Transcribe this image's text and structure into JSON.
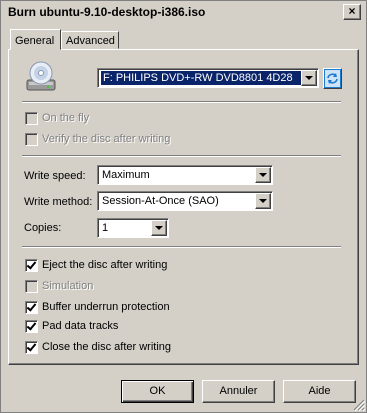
{
  "window": {
    "title": "Burn ubuntu-9.10-desktop-i386.iso",
    "close_label": "×"
  },
  "tabs": [
    {
      "label": "General",
      "active": true
    },
    {
      "label": "Advanced",
      "active": false
    }
  ],
  "drive": {
    "selected": "F: PHILIPS DVD+-RW DVD8801 4D28",
    "icon": "cd-drive-icon"
  },
  "options_top": [
    {
      "label": "On the fly",
      "checked": false,
      "enabled": false
    },
    {
      "label": "Verify the disc after writing",
      "checked": false,
      "enabled": false
    }
  ],
  "write": {
    "speed_label": "Write speed:",
    "speed_value": "Maximum",
    "method_label": "Write method:",
    "method_value": "Session-At-Once (SAO)",
    "copies_label": "Copies:",
    "copies_value": "1"
  },
  "options_bottom": [
    {
      "label": "Eject the disc after writing",
      "checked": true,
      "enabled": true
    },
    {
      "label": "Simulation",
      "checked": false,
      "enabled": false
    },
    {
      "label": "Buffer underrun protection",
      "checked": true,
      "enabled": true
    },
    {
      "label": "Pad data tracks",
      "checked": true,
      "enabled": true
    },
    {
      "label": "Close the disc after writing",
      "checked": true,
      "enabled": true
    }
  ],
  "buttons": {
    "ok": "OK",
    "cancel": "Annuler",
    "help": "Aide"
  },
  "colors": {
    "face": "#d4d0c8",
    "selection": "#0a246a",
    "refresh_icon": "#1c7ad1"
  }
}
